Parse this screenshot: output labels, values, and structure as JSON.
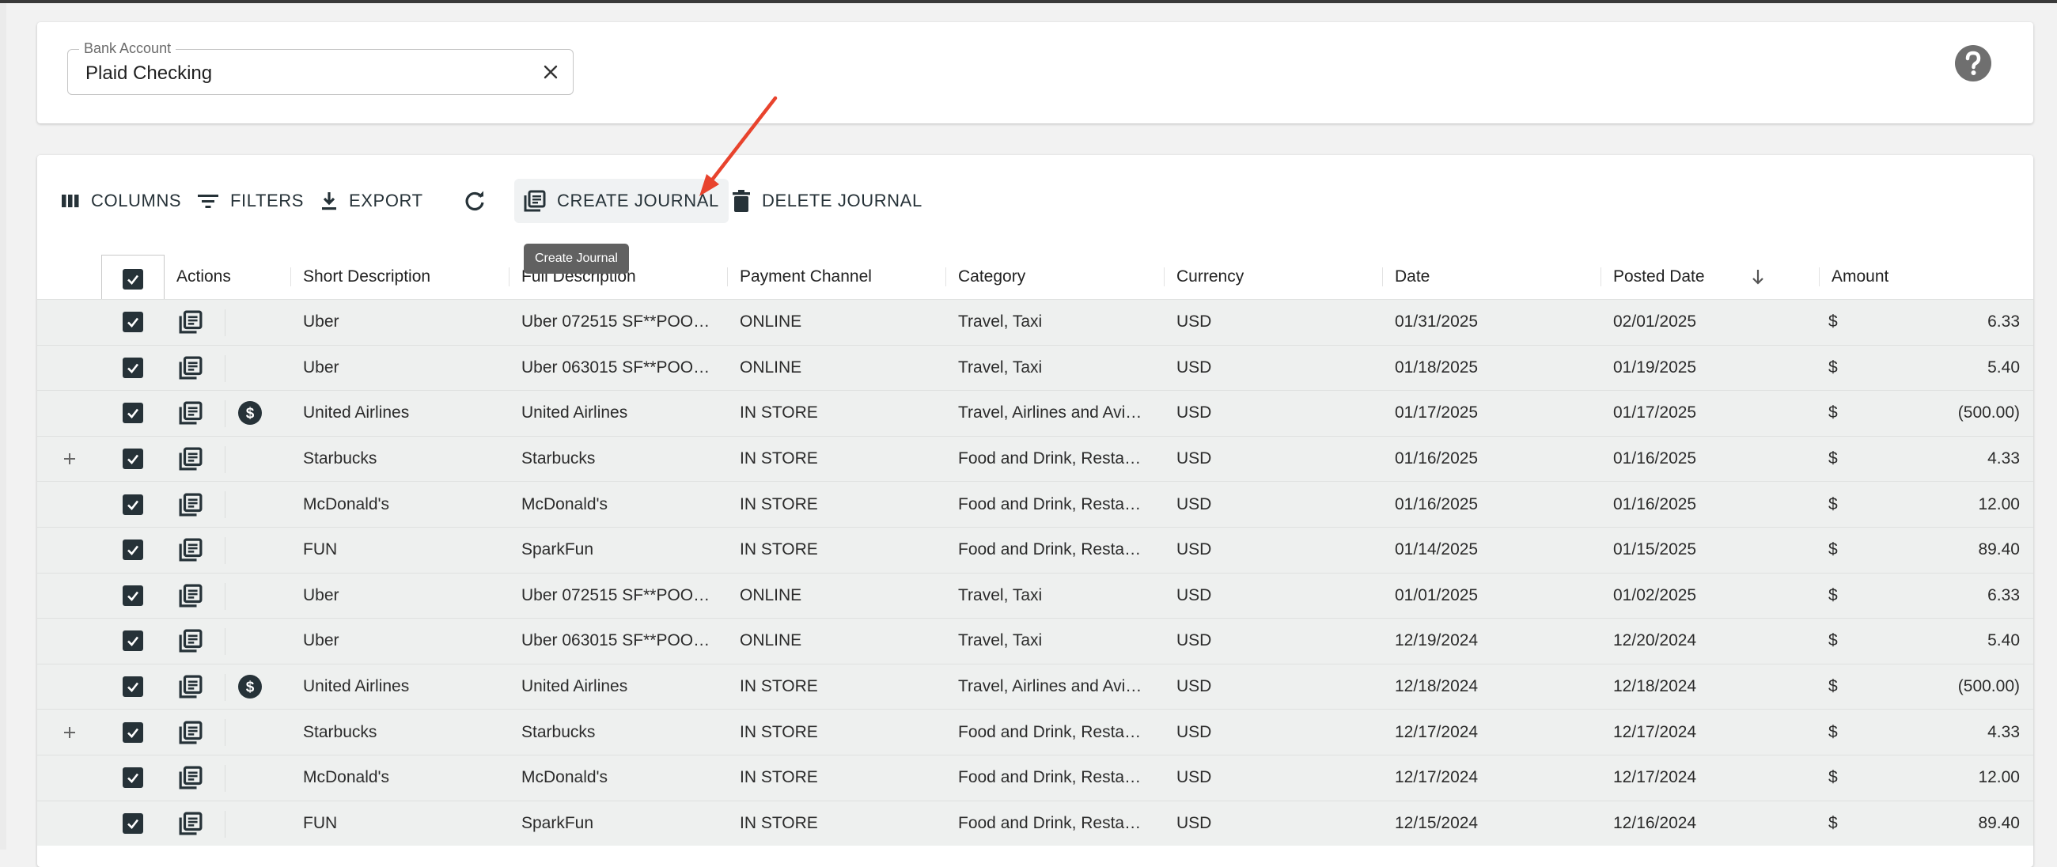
{
  "bank_account": {
    "label": "Bank Account",
    "value": "Plaid Checking"
  },
  "toolbar": {
    "columns": "COLUMNS",
    "filters": "FILTERS",
    "export": "EXPORT",
    "create_journal": "CREATE JOURNAL",
    "delete_journal": "DELETE JOURNAL",
    "tooltip": "Create Journal"
  },
  "table": {
    "headers": [
      "Actions",
      "Short Description",
      "Full Description",
      "Payment Channel",
      "Category",
      "Currency",
      "Date",
      "Posted Date",
      "Amount"
    ],
    "sort": {
      "column": "Posted Date",
      "direction": "descending"
    },
    "rows": [
      {
        "expand": false,
        "dollar": false,
        "short": "Uber",
        "full": "Uber 072515 SF**POO…",
        "channel": "ONLINE",
        "category": "Travel, Taxi",
        "currency": "USD",
        "date": "01/31/2025",
        "posted": "02/01/2025",
        "symbol": "$",
        "amount": "6.33"
      },
      {
        "expand": false,
        "dollar": false,
        "short": "Uber",
        "full": "Uber 063015 SF**POO…",
        "channel": "ONLINE",
        "category": "Travel, Taxi",
        "currency": "USD",
        "date": "01/18/2025",
        "posted": "01/19/2025",
        "symbol": "$",
        "amount": "5.40"
      },
      {
        "expand": false,
        "dollar": true,
        "short": "United Airlines",
        "full": "United Airlines",
        "channel": "IN STORE",
        "category": "Travel, Airlines and Avi…",
        "currency": "USD",
        "date": "01/17/2025",
        "posted": "01/17/2025",
        "symbol": "$",
        "amount": "(500.00)"
      },
      {
        "expand": true,
        "dollar": false,
        "short": "Starbucks",
        "full": "Starbucks",
        "channel": "IN STORE",
        "category": "Food and Drink, Resta…",
        "currency": "USD",
        "date": "01/16/2025",
        "posted": "01/16/2025",
        "symbol": "$",
        "amount": "4.33"
      },
      {
        "expand": false,
        "dollar": false,
        "short": "McDonald's",
        "full": "McDonald's",
        "channel": "IN STORE",
        "category": "Food and Drink, Resta…",
        "currency": "USD",
        "date": "01/16/2025",
        "posted": "01/16/2025",
        "symbol": "$",
        "amount": "12.00"
      },
      {
        "expand": false,
        "dollar": false,
        "short": "FUN",
        "full": "SparkFun",
        "channel": "IN STORE",
        "category": "Food and Drink, Resta…",
        "currency": "USD",
        "date": "01/14/2025",
        "posted": "01/15/2025",
        "symbol": "$",
        "amount": "89.40"
      },
      {
        "expand": false,
        "dollar": false,
        "short": "Uber",
        "full": "Uber 072515 SF**POO…",
        "channel": "ONLINE",
        "category": "Travel, Taxi",
        "currency": "USD",
        "date": "01/01/2025",
        "posted": "01/02/2025",
        "symbol": "$",
        "amount": "6.33"
      },
      {
        "expand": false,
        "dollar": false,
        "short": "Uber",
        "full": "Uber 063015 SF**POO…",
        "channel": "ONLINE",
        "category": "Travel, Taxi",
        "currency": "USD",
        "date": "12/19/2024",
        "posted": "12/20/2024",
        "symbol": "$",
        "amount": "5.40"
      },
      {
        "expand": false,
        "dollar": true,
        "short": "United Airlines",
        "full": "United Airlines",
        "channel": "IN STORE",
        "category": "Travel, Airlines and Avi…",
        "currency": "USD",
        "date": "12/18/2024",
        "posted": "12/18/2024",
        "symbol": "$",
        "amount": "(500.00)"
      },
      {
        "expand": true,
        "dollar": false,
        "short": "Starbucks",
        "full": "Starbucks",
        "channel": "IN STORE",
        "category": "Food and Drink, Resta…",
        "currency": "USD",
        "date": "12/17/2024",
        "posted": "12/17/2024",
        "symbol": "$",
        "amount": "4.33"
      },
      {
        "expand": false,
        "dollar": false,
        "short": "McDonald's",
        "full": "McDonald's",
        "channel": "IN STORE",
        "category": "Food and Drink, Resta…",
        "currency": "USD",
        "date": "12/17/2024",
        "posted": "12/17/2024",
        "symbol": "$",
        "amount": "12.00"
      },
      {
        "expand": false,
        "dollar": false,
        "short": "FUN",
        "full": "SparkFun",
        "channel": "IN STORE",
        "category": "Food and Drink, Resta…",
        "currency": "USD",
        "date": "12/15/2024",
        "posted": "12/16/2024",
        "symbol": "$",
        "amount": "89.40"
      }
    ]
  },
  "icons": {
    "columns": "view-column-icon",
    "filters": "filter-list-icon",
    "export": "download-icon",
    "refresh": "refresh-icon",
    "create_journal": "library-books-icon",
    "delete_journal": "trash-icon",
    "help": "help-circle-icon",
    "clear": "close-icon",
    "row_action": "library-books-icon",
    "dollar": "dollar-circle-icon",
    "expand": "plus-icon",
    "sort": "arrow-down-icon",
    "checkbox": "checkbox-checked-icon"
  },
  "colors": {
    "primary_dark": "#263238",
    "row_background": "#eef0ef",
    "annotation_arrow": "#e8432d",
    "tooltip": "#616161"
  }
}
